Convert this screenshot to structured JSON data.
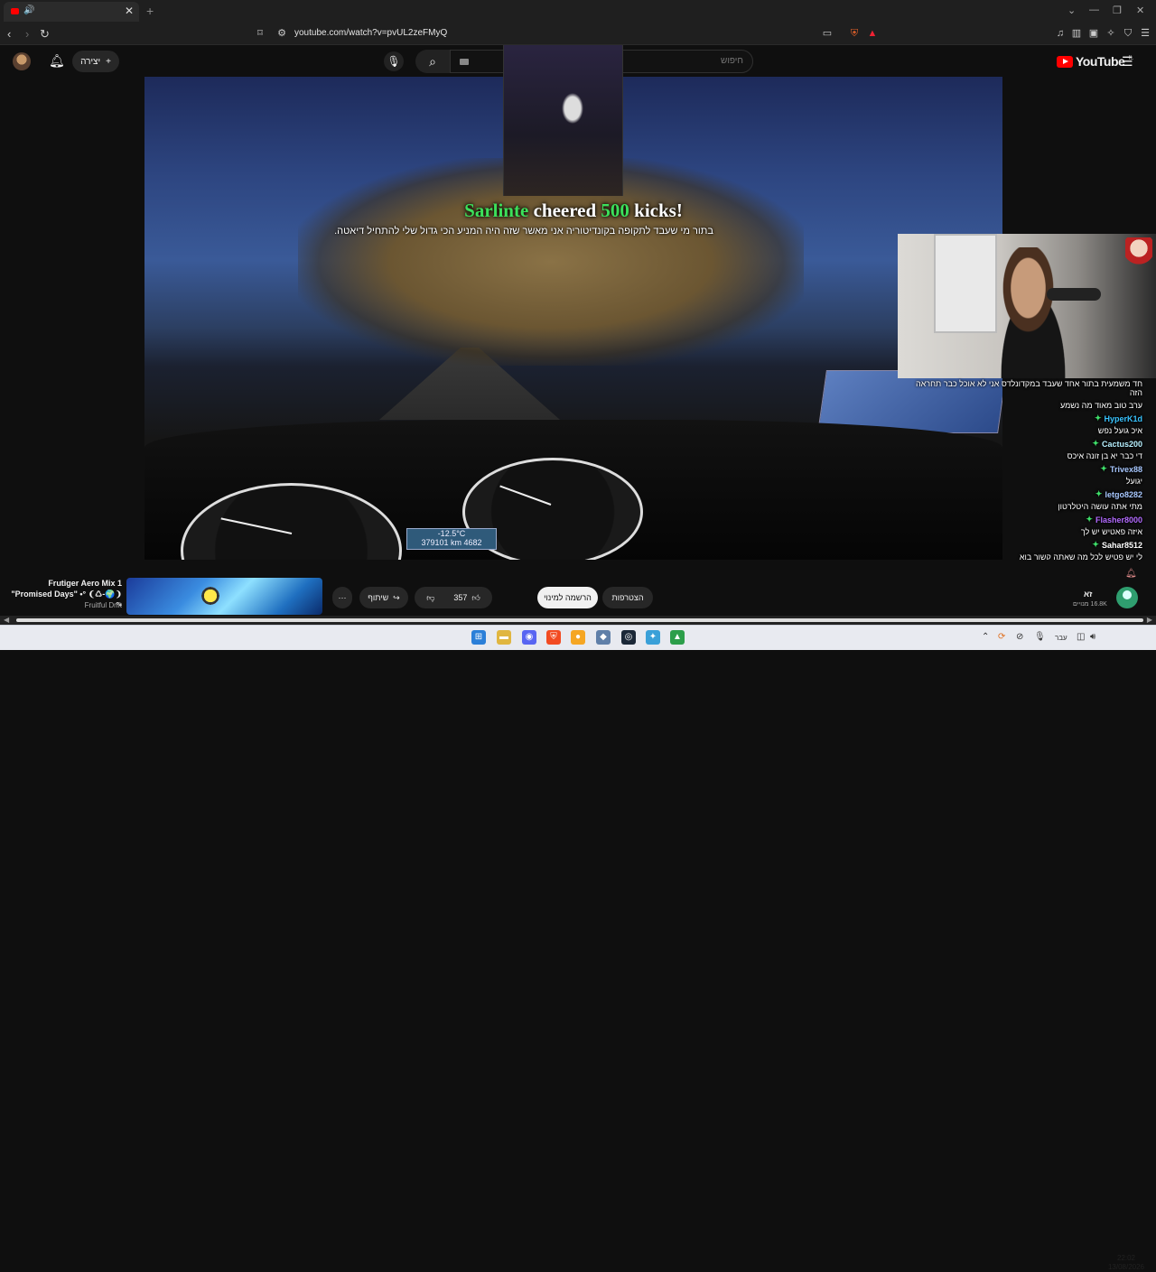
{
  "browser": {
    "url": "youtube.com/watch?v=pvUL2zeFMyQ",
    "new_tab_label": "+",
    "close_tab": "✕"
  },
  "youtube": {
    "logo_text": "YouTube",
    "logo_country": "IL",
    "create_label": "יצירה",
    "search_placeholder": "חיפוש"
  },
  "overlay": {
    "cheer_user": "Sarlinte",
    "cheer_word": "cheered",
    "cheer_amount": "500",
    "cheer_unit": "kicks!",
    "tts_message": "בתור מי שעבד לתקופה בקונדיטוריה אני מאשר שזה היה המניע הכי גדול שלי להתחיל דיאטה.",
    "speed_readout": "379101 km  4682",
    "speed_top": "-12.5°C"
  },
  "chat": {
    "messages": [
      {
        "user": "",
        "text": "חד משמעית בתור אחד שעבד במקדונלדס אני לא אוכל כבר תחראה הזה"
      },
      {
        "user": "",
        "text": "ערב טוב מאוד מה נשמע"
      },
      {
        "user": "HyperK1d",
        "text": "איכ גועל נפש"
      },
      {
        "user": "Cactus200",
        "text": "די כבר יא בן זונה איכס"
      },
      {
        "user": "Trivex88",
        "text": "יגועל"
      },
      {
        "user": "letgo8282",
        "text": "מתי אתה עושה היטלרטון"
      },
      {
        "user": "Flasher8000",
        "text": "איזה פאטיש יש לך"
      },
      {
        "user": "Sahar8512",
        "text": "לי יש פטיש לכל מה שאתה קשור בוא"
      }
    ]
  },
  "player": {
    "song_title": "Frutiger Aero Mix 1 \"Promised Days\" •° ❨♺-🌍❩ °•",
    "song_channel": "Fruitful Drift",
    "like_count": "357",
    "share_label": "שיתוף",
    "join_label": "הצטרפות",
    "subscribe_label": "הרשמה למינוי",
    "channel_name": "זא",
    "subscribers": "16.8K מנויים",
    "more": "···"
  },
  "taskbar": {
    "lang": "עבר",
    "time": "22:02",
    "date": "13/08/2026"
  },
  "colors": {
    "cheer_green": "#3ce05a",
    "youtube_red": "#ff0000",
    "chat_badge": "#3fe06a"
  }
}
